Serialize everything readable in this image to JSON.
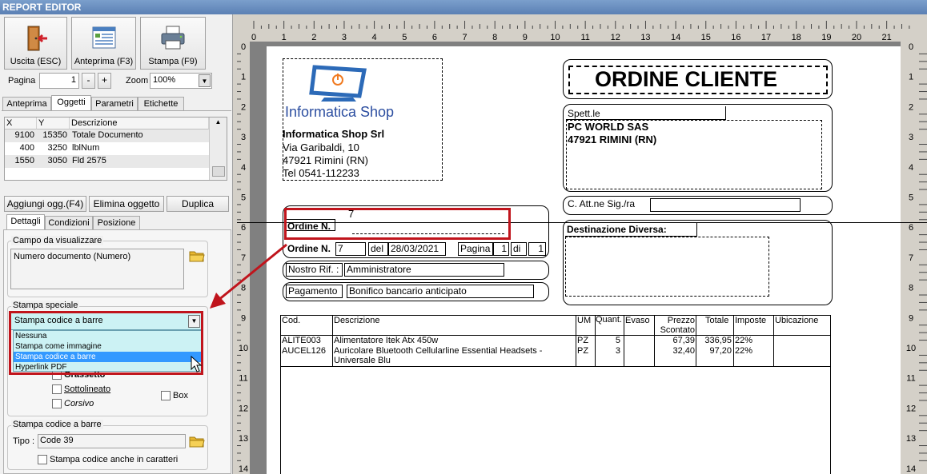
{
  "window": {
    "title": "REPORT EDITOR"
  },
  "toolbar": {
    "exit_label": "Uscita (ESC)",
    "preview_label": "Anteprima (F3)",
    "print_label": "Stampa (F9)",
    "page_label": "Pagina",
    "page_value": "1",
    "minus": "-",
    "plus": "+",
    "zoom_label": "Zoom",
    "zoom_value": "100%"
  },
  "tabs_top": [
    "Anteprima",
    "Oggetti",
    "Parametri",
    "Etichette"
  ],
  "grid": {
    "headers": [
      "X",
      "Y",
      "Descrizione"
    ],
    "rows": [
      {
        "x": "9100",
        "y": "15350",
        "desc": "Totale Documento"
      },
      {
        "x": "400",
        "y": "3250",
        "desc": "lblNum"
      },
      {
        "x": "1550",
        "y": "3050",
        "desc": "Fld 2575"
      }
    ]
  },
  "actions": {
    "add": "Aggiungi ogg.(F4)",
    "delete": "Elimina oggetto",
    "duplicate": "Duplica"
  },
  "tabs_detail": [
    "Dettagli",
    "Condizioni",
    "Posizione"
  ],
  "campo": {
    "title": "Campo da visualizzare",
    "value": "Numero documento (Numero)"
  },
  "stampa_speciale": {
    "title": "Stampa speciale",
    "selected": "Stampa codice a barre",
    "options": [
      "Nessuna",
      "Stampa come immagine",
      "Stampa codice a barre",
      "Hyperlink PDF"
    ]
  },
  "font_opts": {
    "bold": "Grassetto",
    "underline": "Sottolineato",
    "italic": "Corsivo",
    "box": "Box"
  },
  "barcode": {
    "title": "Stampa codice a barre",
    "type_label": "Tipo :",
    "type_value": "Code 39",
    "also_chars": "Stampa codice anche in caratteri"
  },
  "ruler": {
    "top": [
      "0",
      "1",
      "2",
      "3",
      "4",
      "5",
      "6",
      "7",
      "8",
      "9",
      "10",
      "11",
      "12",
      "13",
      "14",
      "15",
      "16",
      "17",
      "18",
      "19",
      "20",
      "21"
    ],
    "side": [
      "0",
      "1",
      "2",
      "3",
      "4",
      "5",
      "6",
      "7",
      "8",
      "9",
      "10",
      "11",
      "12",
      "13",
      "14"
    ]
  },
  "report": {
    "logo_text": "Informatica Shop",
    "company": {
      "name": "Informatica Shop Srl",
      "street": "Via Garibaldi, 10",
      "city": "47921 Rimini (RN)",
      "phone": "Tel 0541-112233"
    },
    "title": "ORDINE CLIENTE",
    "spett_label": "Spett.le",
    "customer": {
      "name": "PC WORLD SAS",
      "city": "47921 RIMINI (RN)"
    },
    "att_label": "C. Att.ne Sig./ra",
    "ordine_small_label": "Ordine N.",
    "ordine_small_value": "7",
    "ordine_label": "Ordine N.",
    "ordine_value": "7",
    "del_label": "del",
    "date": "28/03/2021",
    "pagina_label": "Pagina",
    "pagina_value": "1",
    "di_label": "di",
    "di_value": "1",
    "rif_label": "Nostro Rif. :",
    "rif_value": "Amministratore",
    "pagamento_label": "Pagamento",
    "pagamento_value": "Bonifico bancario anticipato",
    "destinazione": "Destinazione Diversa:",
    "table_headers": [
      "Cod.",
      "Descrizione",
      "UM",
      "Quant.",
      "Evaso",
      "Prezzo Scontato",
      "Totale",
      "Imposte",
      "Ubicazione"
    ],
    "table_rows": [
      {
        "cod": "ALITE003",
        "desc": "Alimentatore Itek Atx 450w",
        "um": "PZ",
        "qty": "5",
        "evaso": "",
        "prezzo": "67,39",
        "totale": "336,95",
        "imposte": "22%",
        "ubic": ""
      },
      {
        "cod": "AUCEL126",
        "desc": "Auricolare Bluetooth Cellularline Essential Headsets - Universale Blu",
        "um": "PZ",
        "qty": "3",
        "evaso": "",
        "prezzo": "32,40",
        "totale": "97,20",
        "imposte": "22%",
        "ubic": ""
      }
    ]
  },
  "colors": {
    "accent_red": "#c0141c",
    "selection": "#3399ff",
    "dropdown_bg": "#ccf2f4"
  }
}
